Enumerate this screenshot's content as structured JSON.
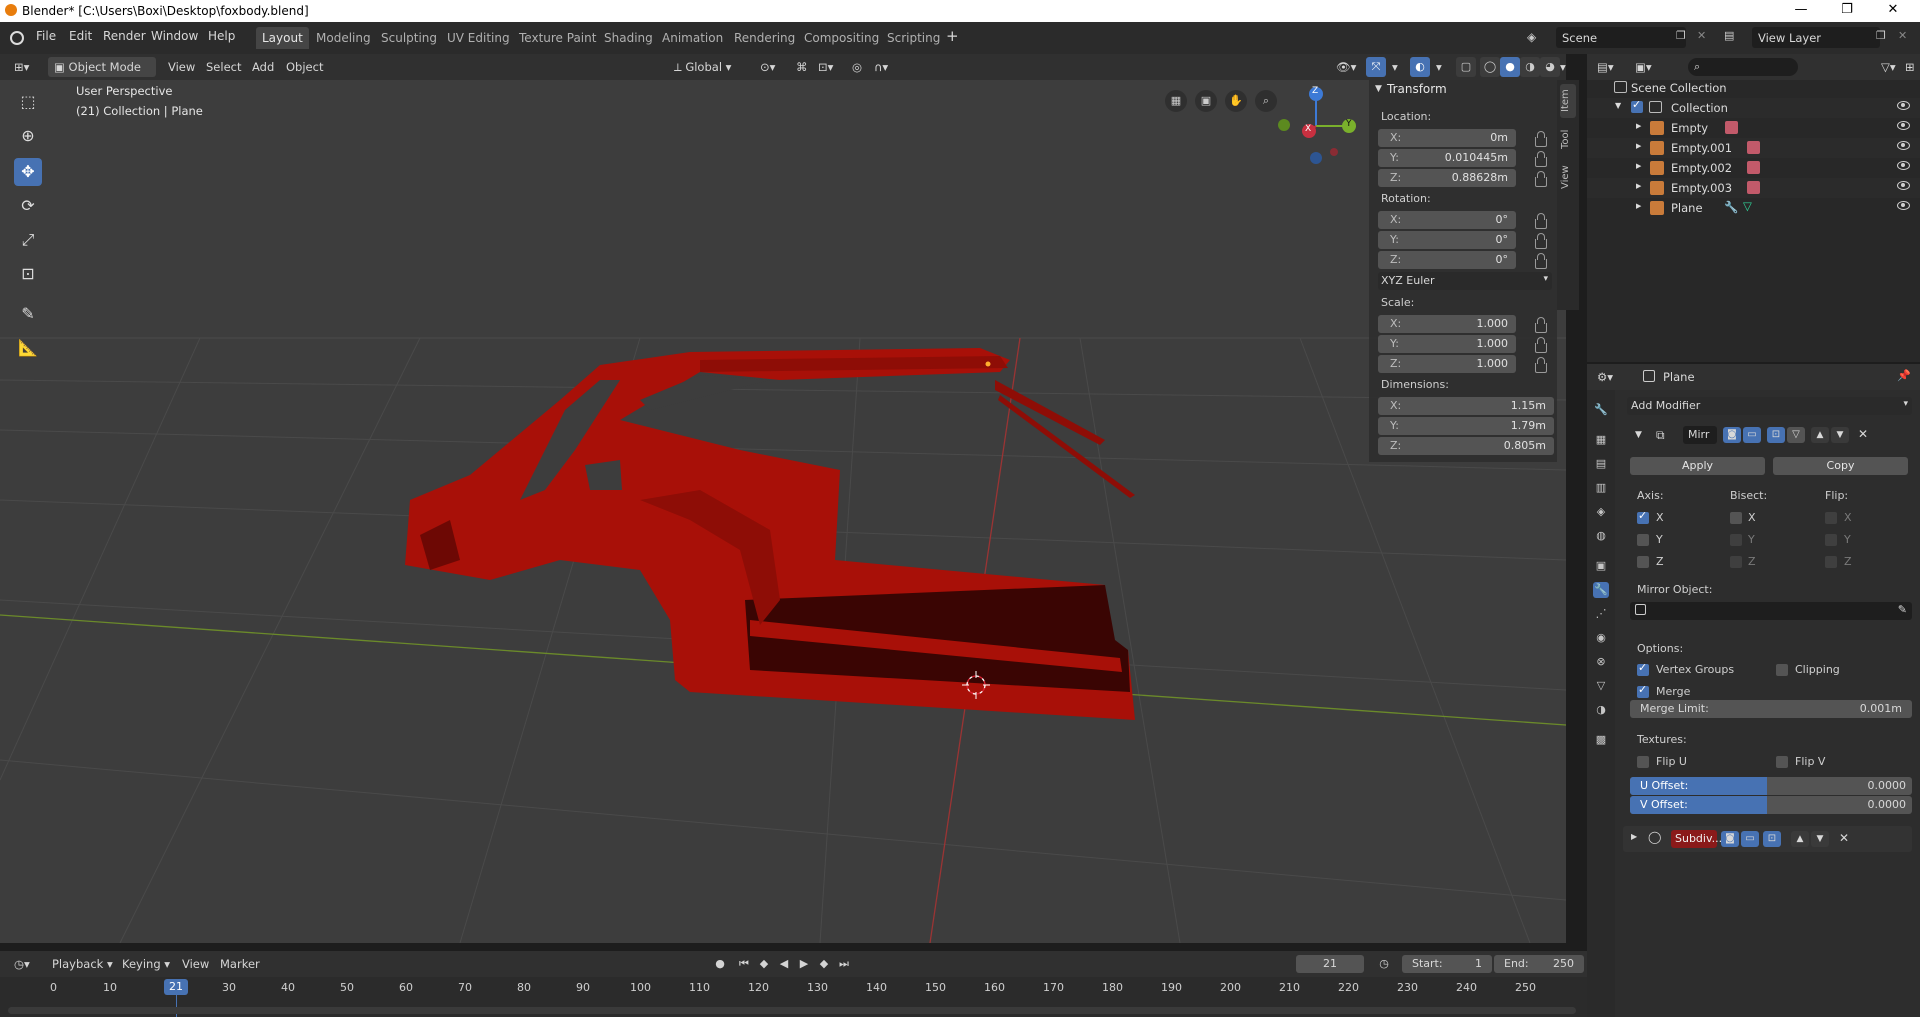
{
  "window": {
    "title": "Blender* [C:\\Users\\Boxi\\Desktop\\foxbody.blend]"
  },
  "menu": [
    "File",
    "Edit",
    "Render",
    "Window",
    "Help"
  ],
  "workspaces": [
    "Layout",
    "Modeling",
    "Sculpting",
    "UV Editing",
    "Texture Paint",
    "Shading",
    "Animation",
    "Rendering",
    "Compositing",
    "Scripting"
  ],
  "scene": {
    "name": "Scene",
    "view_layer": "View Layer"
  },
  "viewport_header": {
    "mode": "Object Mode",
    "view": "View",
    "select": "Select",
    "add": "Add",
    "object": "Object",
    "orientation": "Global"
  },
  "viewport_info": {
    "perspective": "User Perspective",
    "collection": "(21) Collection | Plane"
  },
  "gizmo": {
    "x": "X",
    "y": "Y",
    "z": "Z"
  },
  "npanel": {
    "title": "Transform",
    "location_label": "Location:",
    "location": [
      {
        "axis": "X:",
        "value": "0m"
      },
      {
        "axis": "Y:",
        "value": "0.010445m"
      },
      {
        "axis": "Z:",
        "value": "0.88628m"
      }
    ],
    "rotation_label": "Rotation:",
    "rotation": [
      {
        "axis": "X:",
        "value": "0°"
      },
      {
        "axis": "Y:",
        "value": "0°"
      },
      {
        "axis": "Z:",
        "value": "0°"
      }
    ],
    "rotation_mode": "XYZ Euler",
    "scale_label": "Scale:",
    "scale": [
      {
        "axis": "X:",
        "value": "1.000"
      },
      {
        "axis": "Y:",
        "value": "1.000"
      },
      {
        "axis": "Z:",
        "value": "1.000"
      }
    ],
    "dimensions_label": "Dimensions:",
    "dimensions": [
      {
        "axis": "X:",
        "value": "1.15m"
      },
      {
        "axis": "Y:",
        "value": "1.79m"
      },
      {
        "axis": "Z:",
        "value": "0.805m"
      }
    ],
    "tabs": [
      "Item",
      "Tool",
      "View"
    ]
  },
  "outliner": {
    "root": "Scene Collection",
    "collection": "Collection",
    "items": [
      "Empty",
      "Empty.001",
      "Empty.002",
      "Empty.003",
      "Plane"
    ]
  },
  "properties": {
    "object": "Plane",
    "add_modifier": "Add Modifier",
    "mirror_name": "Mirr",
    "apply": "Apply",
    "copy": "Copy",
    "axis_label": "Axis:",
    "bisect_label": "Bisect:",
    "flip_label": "Flip:",
    "axes": [
      "X",
      "Y",
      "Z"
    ],
    "mirror_object_label": "Mirror Object:",
    "options_label": "Options:",
    "vertex_groups": "Vertex Groups",
    "clipping": "Clipping",
    "merge": "Merge",
    "merge_limit_label": "Merge Limit:",
    "merge_limit": "0.001m",
    "textures_label": "Textures:",
    "flip_u": "Flip U",
    "flip_v": "Flip V",
    "u_offset_label": "U Offset:",
    "u_offset": "0.0000",
    "v_offset_label": "V Offset:",
    "v_offset": "0.0000",
    "subdiv_name": "Subdiv..."
  },
  "timeline": {
    "playback": "Playback",
    "keying": "Keying",
    "view": "View",
    "marker": "Marker",
    "current_frame": "21",
    "start_label": "Start:",
    "start": "1",
    "end_label": "End:",
    "end": "250",
    "ticks": [
      "0",
      "10",
      "21",
      "30",
      "40",
      "50",
      "60",
      "70",
      "80",
      "90",
      "100",
      "110",
      "120",
      "130",
      "140",
      "150",
      "160",
      "170",
      "180",
      "190",
      "200",
      "210",
      "220",
      "230",
      "240",
      "250"
    ]
  },
  "colors": {
    "accent": "#4772b3",
    "mesh": "#a81008",
    "mesh_dark": "#3a0503"
  }
}
